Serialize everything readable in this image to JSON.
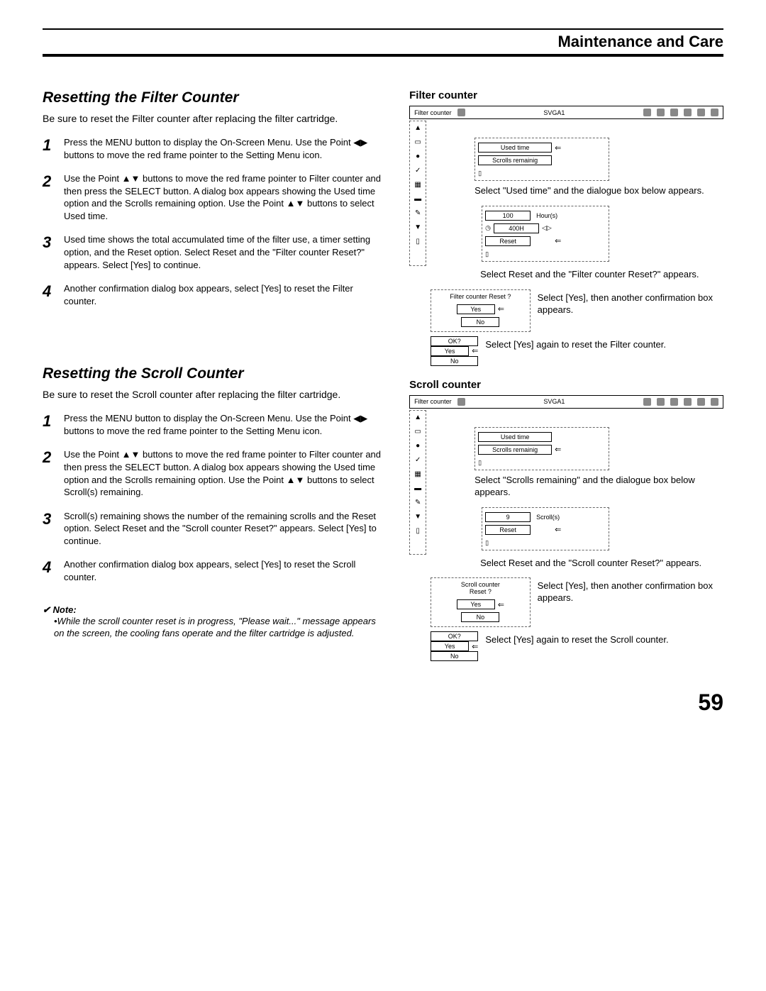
{
  "header": "Maintenance and Care",
  "filterSection": {
    "title": "Resetting the Filter Counter",
    "intro": "Be sure to reset the Filter counter after replacing the filter cartridge.",
    "steps": [
      "Press the MENU button to display the On-Screen Menu. Use the Point ◀▶ buttons to move the red frame pointer to the Setting Menu icon.",
      "Use the Point ▲▼ buttons to move the red frame pointer to Filter counter and then press the SELECT button. A dialog box appears showing the Used time option and the Scrolls remaining option. Use the Point ▲▼ buttons to select Used time.",
      "Used time shows the total accumulated time of the filter use, a timer setting option, and the Reset option. Select Reset and the \"Filter counter Reset?\" appears. Select [Yes] to continue.",
      "Another confirmation dialog box appears, select [Yes] to reset the Filter counter."
    ]
  },
  "scrollSection": {
    "title": "Resetting the Scroll Counter",
    "intro": "Be sure to reset the Scroll counter after replacing the filter cartridge.",
    "steps": [
      "Press the MENU button to display the On-Screen Menu. Use the Point ◀▶ buttons to move the red frame pointer to the Setting Menu icon.",
      "Use the Point ▲▼ buttons to move the red frame pointer to Filter counter and then press the SELECT button. A dialog box appears showing the Used time option and the Scrolls remaining option. Use the Point ▲▼ buttons to select Scroll(s) remaining.",
      "Scroll(s) remaining shows the number of the remaining scrolls and the Reset option. Select Reset and the \"Scroll counter Reset?\" appears. Select [Yes] to continue.",
      "Another confirmation dialog box appears, select [Yes] to reset the Scroll counter."
    ]
  },
  "note": {
    "head": "Note:",
    "body": "•While the scroll counter reset is in progress, \"Please wait...\" message appears on the screen, the cooling fans operate and the filter cartridge is adjusted."
  },
  "right": {
    "filter": {
      "heading": "Filter counter",
      "menubar_label": "Filter counter",
      "menubar_mode": "SVGA1",
      "opt_used": "Used time",
      "opt_scrolls": "Scrolls remainig",
      "cap1": "Select \"Used time\" and the dialogue box below appears.",
      "val100": "100",
      "hours": "Hour(s)",
      "val400": "400H",
      "reset": "Reset",
      "cap2": "Select Reset and the \"Filter counter Reset?\" appears.",
      "resetq": "Filter counter Reset ?",
      "yes": "Yes",
      "no": "No",
      "cap3": "Select [Yes], then another confirmation box appears.",
      "ok": "OK?",
      "cap4": "Select [Yes] again to reset the Filter counter."
    },
    "scroll": {
      "heading": "Scroll counter",
      "cap1": "Select \"Scrolls remaining\" and the dialogue box below appears.",
      "val9": "9",
      "scrolls": "Scroll(s)",
      "reset": "Reset",
      "cap2": "Select Reset and the \"Scroll counter Reset?\" appears.",
      "resetq1": "Scroll counter",
      "resetq2": "Reset ?",
      "cap3": "Select [Yes], then another confirmation box appears.",
      "cap4": "Select [Yes] again to reset the Scroll counter."
    }
  },
  "pageNum": "59"
}
